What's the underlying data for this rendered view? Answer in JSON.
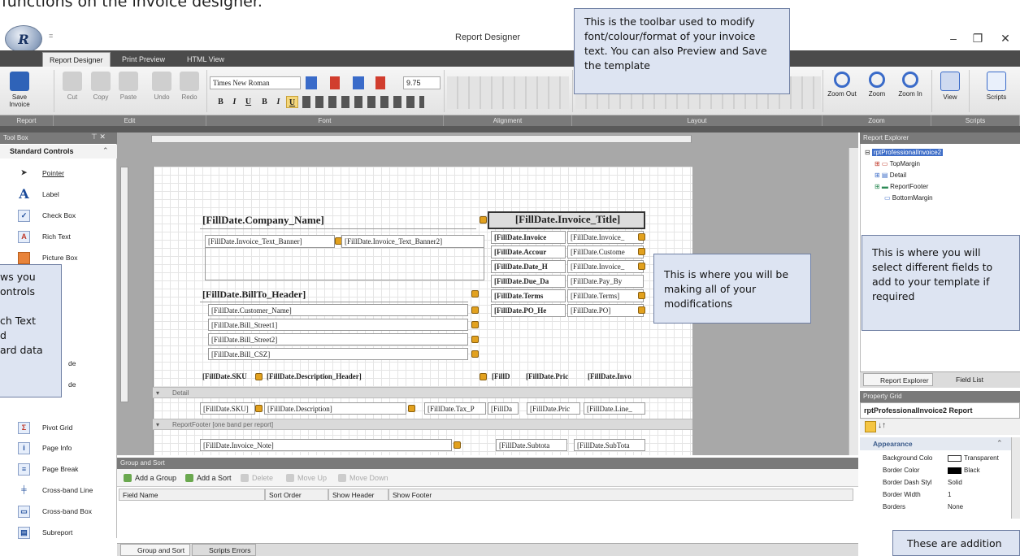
{
  "page_heading": "functions on the invoice designer.",
  "window": {
    "title": "Report Designer",
    "quick_access": "="
  },
  "ribbon_tabs": [
    "Report Designer",
    "Print Preview",
    "HTML View"
  ],
  "ribbon": {
    "buttons": {
      "save": "Save Invoice",
      "cut": "Cut",
      "copy": "Copy",
      "paste": "Paste",
      "undo": "Undo",
      "redo": "Redo",
      "zoom_out": "Zoom Out",
      "zoom": "Zoom",
      "zoom_in": "Zoom In",
      "view": "View",
      "scripts": "Scripts"
    },
    "font_name": "Times New Roman",
    "font_size": "9.75",
    "format_buttons": [
      "B",
      "I",
      "U",
      "B",
      "I",
      "U"
    ],
    "groups": [
      "Report",
      "Edit",
      "Font",
      "Alignment",
      "Layout",
      "Zoom",
      "Scripts"
    ]
  },
  "callouts": {
    "toolbar": "This is the toolbar used to modify font/colour/format of your invoice text. You can also Preview and Save the template",
    "design": "This is where you will be making all of your modifications",
    "fields": "This is where you will select different fields to add to your template if required",
    "toolbox_lines": [
      "ws you",
      "ontrols",
      "",
      "ch Text",
      "d",
      "ard data"
    ],
    "bottom": "These are addition"
  },
  "toolbox": {
    "header": "Tool Box",
    "section": "Standard Controls",
    "items_top": [
      "Pointer",
      "Label",
      "Check Box",
      "Rich Text",
      "Picture Box"
    ],
    "partial_items": [
      "de",
      "de"
    ],
    "items_bottom": [
      "Pivot Grid",
      "Page Info",
      "Page Break",
      "Cross-band Line",
      "Cross-band Box",
      "Subreport"
    ]
  },
  "design": {
    "company": "[FillDate.Company_Name]",
    "invoice_title": "[FillDate.Invoice_Title]",
    "banner1": "[FillDate.Invoice_Text_Banner]",
    "banner2": "[FillDate.Invoice_Text_Banner2]",
    "right_labels": [
      "[FillDate.Invoice",
      "[FillDate.Accour",
      "[FillDate.Date_H",
      "[FillDate.Due_Da",
      "[FillDate.Terms",
      "[FillDate.PO_He"
    ],
    "right_values": [
      "[FillDate.Invoice_",
      "[FillDate.Custome",
      "[FillDate.Invoice_",
      "[FillDate.Pay_By",
      "[FillDate.Terms]",
      "[FillDate.PO]"
    ],
    "billto": "[FillDate.BillTo_Header]",
    "bill_lines": [
      "[FillDate.Customer_Name]",
      "[FillDate.Bill_Street1]",
      "[FillDate.Bill_Street2]",
      "[FillDate.Bill_CSZ]"
    ],
    "header_row": [
      "[FillDate.SKU",
      "[FillDate.Description_Header]",
      "[FillD",
      "[FillDate.Pric",
      "[FillDate.Invo"
    ],
    "detail_band": "Detail",
    "detail_row": [
      "[FillDate.SKU]",
      "[FillDate.Description]",
      "[FillDate.Tax_P",
      "[FillDa",
      "[FillDate.Pric",
      "[FillDate.Line_"
    ],
    "footer_band": "ReportFooter [one band per report]",
    "footer_row": [
      "[FillDate.Invoice_Note]",
      "[FillDate.Subtota",
      "[FillDate.SubTota"
    ]
  },
  "explorer": {
    "header": "Report Explorer",
    "root": "rptProfessionalInvoice2",
    "children": [
      "TopMargin",
      "Detail",
      "ReportFooter",
      "BottomMargin"
    ],
    "tabs": [
      "Report Explorer",
      "Field List"
    ]
  },
  "property_grid": {
    "header": "Property Grid",
    "selected": "rptProfessionalInvoice2  Report",
    "section": "Appearance",
    "rows": [
      {
        "name": "Background Colo",
        "value": "Transparent"
      },
      {
        "name": "Border Color",
        "value": "Black"
      },
      {
        "name": "Border Dash Styl",
        "value": "Solid"
      },
      {
        "name": "Border Width",
        "value": "1"
      },
      {
        "name": "Borders",
        "value": "None"
      }
    ]
  },
  "group_sort": {
    "header": "Group and Sort",
    "buttons": [
      "Add a Group",
      "Add a Sort",
      "Delete",
      "Move Up",
      "Move Down"
    ],
    "columns": [
      "Field Name",
      "Sort Order",
      "Show Header",
      "Show Footer"
    ],
    "tabs": [
      "Group and Sort",
      "Scripts Errors"
    ]
  },
  "colors": {
    "accent": "#3f6ec8",
    "callout_bg": "#dde4f2",
    "callout_border": "#6f7fa3",
    "ribbon_dark": "#4b4b4b"
  }
}
